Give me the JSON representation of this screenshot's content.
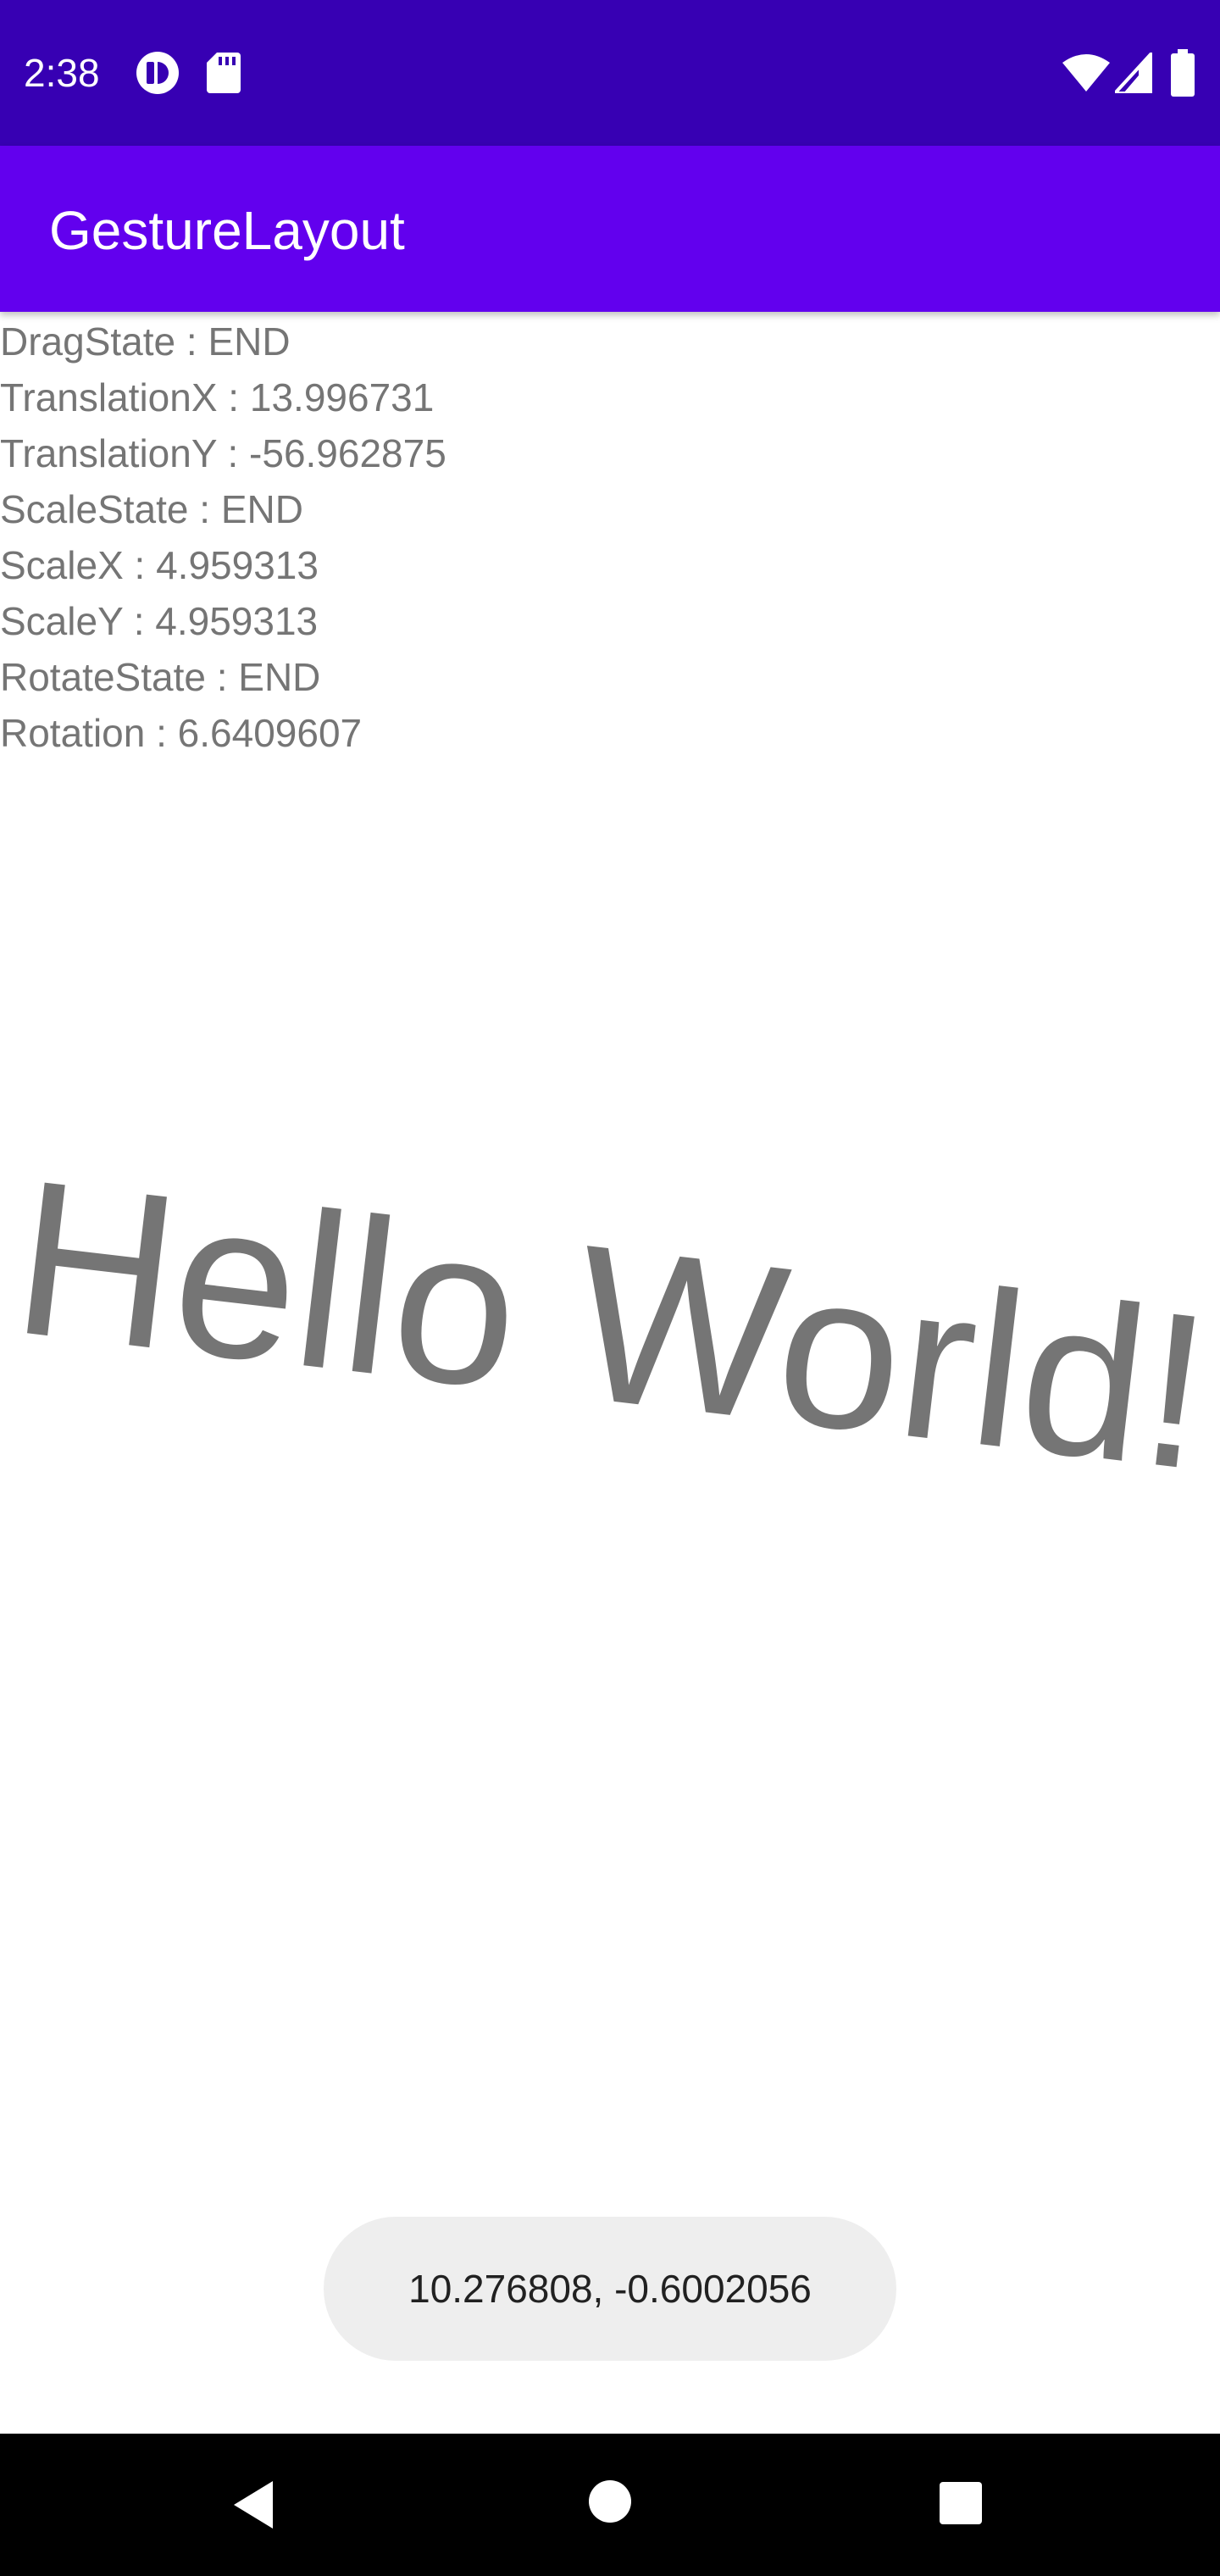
{
  "status_bar": {
    "time": "2:38",
    "icons": [
      "circle-logo-icon",
      "sd-card-icon",
      "wifi-icon",
      "cellular-signal-icon",
      "battery-icon"
    ]
  },
  "app_bar": {
    "title": "GestureLayout"
  },
  "info": {
    "lines": [
      "DragState : END",
      "TranslationX : 13.996731",
      "TranslationY : -56.962875",
      "ScaleState : END",
      "ScaleX : 4.959313",
      "ScaleY : 4.959313",
      "RotateState : END",
      "Rotation : 6.6409607"
    ]
  },
  "content": {
    "hello_text": "Hello World!",
    "rotation_degrees": 6.6409607
  },
  "toast": {
    "text": "10.276808, -0.6002056"
  },
  "nav_bar": {
    "buttons": [
      "back-icon",
      "home-icon",
      "recents-icon"
    ]
  },
  "colors": {
    "status_bar": "#3700b3",
    "app_bar": "#6200ee",
    "text_gray": "#757575",
    "toast_bg": "#eeeeee"
  }
}
